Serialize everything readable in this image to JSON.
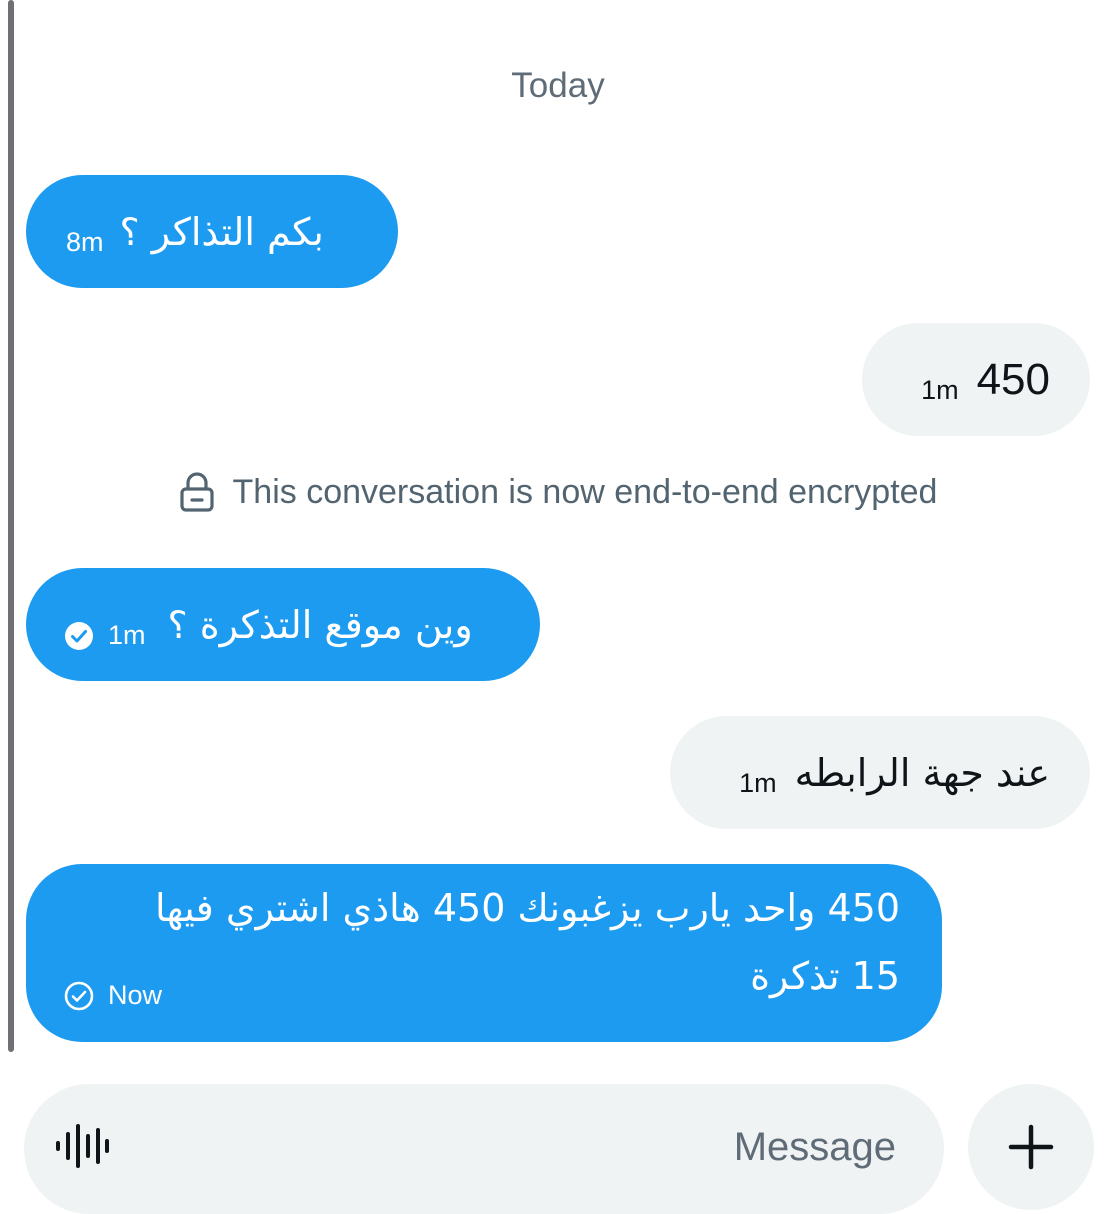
{
  "date_divider": "Today",
  "encryption_notice": "This conversation is now end-to-end encrypted",
  "messages": [
    {
      "side": "sent",
      "text": "بكم التذاكر ؟",
      "time": "8m"
    },
    {
      "side": "received",
      "text": "450",
      "time": "1m"
    },
    {
      "side": "sent",
      "text": "وين موقع التذكرة ؟",
      "time": "1m",
      "status_icon": "check-circle-filled-icon"
    },
    {
      "side": "received",
      "text": "عند جهة الرابطه",
      "time": "1m"
    },
    {
      "side": "sent",
      "text_line1": "450 واحد يارب يزغبونك 450 هاذي اشتري فيها",
      "text_line2": "15 تذكرة",
      "time": "Now",
      "status_icon": "check-circle-outline-icon"
    }
  ],
  "composer": {
    "placeholder": "Message",
    "voice_icon": "voice-waveform-icon",
    "plus_icon": "plus-icon"
  },
  "colors": {
    "sent_bubble": "#1d9bf0",
    "received_bubble": "#eff3f4",
    "muted_text": "#536471"
  }
}
